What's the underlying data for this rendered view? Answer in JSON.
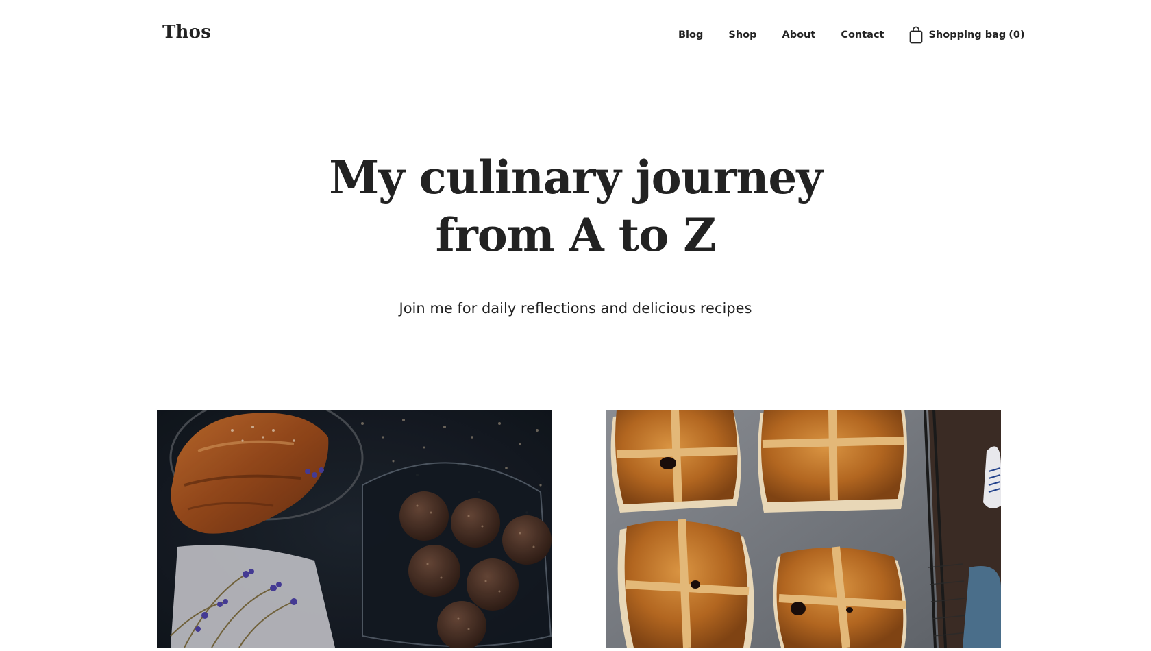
{
  "header": {
    "logo": "Thos",
    "nav": [
      {
        "label": "Blog"
      },
      {
        "label": "Shop"
      },
      {
        "label": "About"
      },
      {
        "label": "Contact"
      }
    ],
    "cart": {
      "label": "Shopping bag",
      "count": "(0)",
      "icon": "shopping-bag-icon"
    }
  },
  "hero": {
    "title_line1": "My culinary journey",
    "title_line2": "from A to Z",
    "subtitle": "Join me for daily reflections and delicious recipes"
  },
  "posts": [
    {
      "image": "pastry-and-chocolate-truffles-photo"
    },
    {
      "image": "hot-cross-buns-photo"
    }
  ]
}
